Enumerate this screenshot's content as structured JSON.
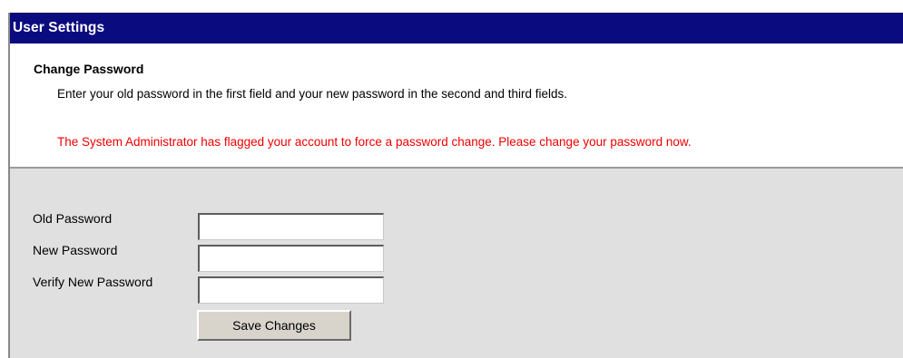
{
  "header": {
    "title": "User Settings"
  },
  "change_password": {
    "title": "Change Password",
    "description": "Enter your old password in the first field and your new password in the second and third fields.",
    "warning": "The System Administrator has flagged your account to force a password change. Please change your password now."
  },
  "form": {
    "fields": [
      {
        "label": "Old Password",
        "value": ""
      },
      {
        "label": "New Password",
        "value": ""
      },
      {
        "label": "Verify New Password",
        "value": ""
      }
    ],
    "save_label": "Save Changes"
  },
  "colors": {
    "header_background": "#0b0b80",
    "header_text": "#ffffff",
    "warning_text": "#f00000",
    "form_background": "#e0e0e0"
  }
}
